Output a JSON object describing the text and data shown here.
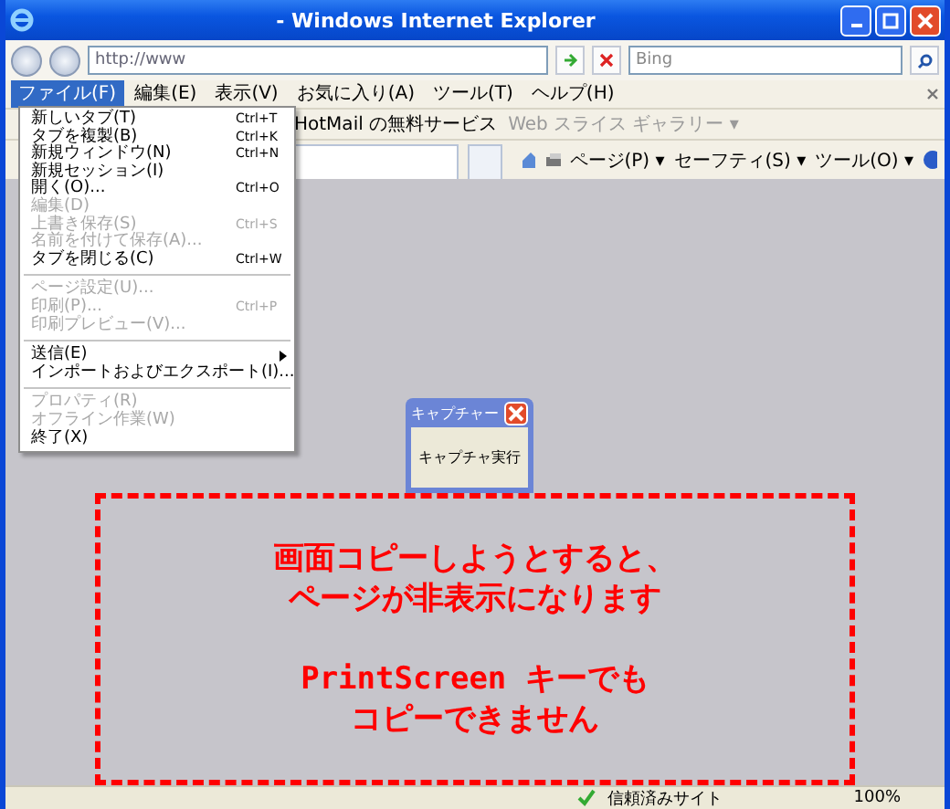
{
  "window": {
    "title": "- Windows Internet Explorer"
  },
  "address_bar": {
    "url": "http://www",
    "search_placeholder": "Bing"
  },
  "menu_bar": [
    {
      "label": "ファイル(F)",
      "selected": true
    },
    {
      "label": "編集(E)",
      "selected": false
    },
    {
      "label": "表示(V)",
      "selected": false
    },
    {
      "label": "お気に入り(A)",
      "selected": false
    },
    {
      "label": "ツール(T)",
      "selected": false
    },
    {
      "label": "ヘルプ(H)",
      "selected": false
    }
  ],
  "favorites_bar": [
    {
      "label": "HotMail の無料サービス",
      "disabled": false
    },
    {
      "label": "Web スライス ギャラリー ▾",
      "disabled": true
    }
  ],
  "command_bar": [
    {
      "label": "ページ(P) ▾"
    },
    {
      "label": "セーフティ(S) ▾"
    },
    {
      "label": "ツール(O) ▾"
    }
  ],
  "file_menu": [
    {
      "kind": "item",
      "label": "新しいタブ(T)",
      "shortcut": "Ctrl+T",
      "disabled": false
    },
    {
      "kind": "item",
      "label": "タブを複製(B)",
      "shortcut": "Ctrl+K",
      "disabled": false
    },
    {
      "kind": "item",
      "label": "新規ウィンドウ(N)",
      "shortcut": "Ctrl+N",
      "disabled": false
    },
    {
      "kind": "item",
      "label": "新規セッション(I)",
      "disabled": false
    },
    {
      "kind": "item",
      "label": "開く(O)...",
      "shortcut": "Ctrl+O",
      "disabled": false
    },
    {
      "kind": "item",
      "label": "編集(D)",
      "disabled": true
    },
    {
      "kind": "item",
      "label": "上書き保存(S)",
      "shortcut": "Ctrl+S",
      "disabled": true
    },
    {
      "kind": "item",
      "label": "名前を付けて保存(A)...",
      "disabled": true
    },
    {
      "kind": "item",
      "label": "タブを閉じる(C)",
      "shortcut": "Ctrl+W",
      "disabled": false
    },
    {
      "kind": "separator"
    },
    {
      "kind": "item",
      "label": "ページ設定(U)...",
      "disabled": true
    },
    {
      "kind": "item",
      "label": "印刷(P)...",
      "shortcut": "Ctrl+P",
      "disabled": true
    },
    {
      "kind": "item",
      "label": "印刷プレビュー(V)...",
      "disabled": true
    },
    {
      "kind": "separator"
    },
    {
      "kind": "submenu",
      "label": "送信(E)",
      "disabled": false
    },
    {
      "kind": "item",
      "label": "インポートおよびエクスポート(I)...",
      "disabled": false
    },
    {
      "kind": "separator"
    },
    {
      "kind": "item",
      "label": "プロパティ(R)",
      "disabled": true
    },
    {
      "kind": "item",
      "label": "オフライン作業(W)",
      "disabled": true
    },
    {
      "kind": "item",
      "label": "終了(X)",
      "disabled": false
    }
  ],
  "capture_dialog": {
    "title": "キャプチャー",
    "button": "キャプチャ実行"
  },
  "notice": {
    "paragraphs": [
      [
        "画面コピーしようとすると、",
        "ページが非表示になります"
      ],
      [
        "PrintScreen キーでも",
        "コピーできません"
      ]
    ]
  },
  "status_bar": {
    "zone": "信頼済みサイト",
    "zoom": "100%"
  }
}
